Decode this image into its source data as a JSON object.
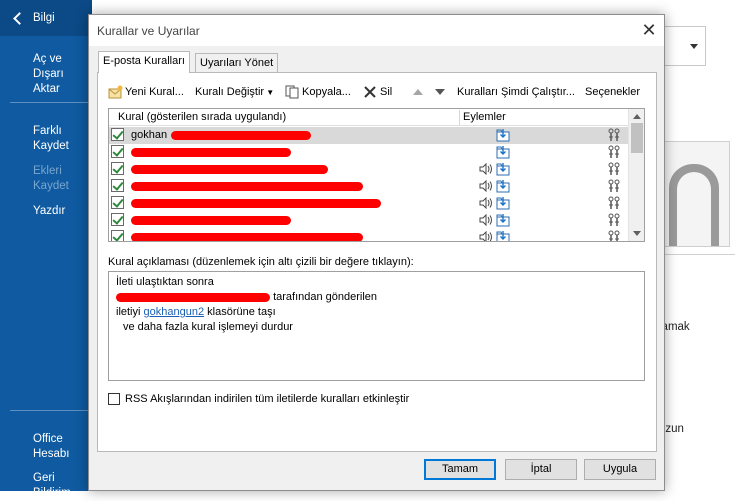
{
  "backstage": {
    "items": [
      {
        "label": "Bilgi"
      },
      {
        "label": "Aç ve Dışarı Aktar"
      },
      {
        "label": "Farklı Kaydet"
      },
      {
        "label": "Ekleri Kaydet"
      },
      {
        "label": "Yazdır"
      },
      {
        "label": "Office Hesabı"
      },
      {
        "label": "Geri Bildirim"
      }
    ]
  },
  "background": {
    "right_text_1": "lamak",
    "right_text_2": "uzun"
  },
  "dialog": {
    "title": "Kurallar ve Uyarılar",
    "close_symbol": "✕",
    "tabs": [
      {
        "label": "E-posta Kuralları",
        "selected": true
      },
      {
        "label": "Uyarıları Yönet",
        "selected": false
      }
    ],
    "toolbar": {
      "new_rule": "Yeni Kural...",
      "change_rule": "Kuralı Değiştir",
      "copy": "Kopyala...",
      "delete": "Sil",
      "run_now": "Kuralları Şimdi Çalıştır...",
      "options": "Seçenekler"
    },
    "rules_list": {
      "col_rule": "Kural (gösterilen sırada uygulandı)",
      "col_actions": "Eylemler",
      "rows": [
        {
          "name": "gokhan",
          "checked": true,
          "selected": true,
          "sound": false
        },
        {
          "name": "",
          "checked": true,
          "selected": false,
          "sound": false
        },
        {
          "name": "",
          "checked": true,
          "selected": false,
          "sound": true
        },
        {
          "name": "",
          "checked": true,
          "selected": false,
          "sound": true
        },
        {
          "name": "",
          "checked": true,
          "selected": false,
          "sound": true
        },
        {
          "name": "",
          "checked": true,
          "selected": false,
          "sound": true
        },
        {
          "name": "",
          "checked": true,
          "selected": false,
          "sound": true
        }
      ]
    },
    "description": {
      "label": "Kural açıklaması (düzenlemek için altı çizili bir değere tıklayın):",
      "line1": "İleti ulaştıktan sonra",
      "line2_suffix": "tarafından gönderilen",
      "line3_prefix": "iletiyi",
      "line3_link": "gokhangun2",
      "line3_suffix": "klasörüne taşı",
      "line4": "ve daha fazla kural işlemeyi durdur"
    },
    "rss_checkbox": {
      "label": "RSS Akışlarından indirilen tüm iletilerde kuralları etkinleştir",
      "checked": false
    },
    "buttons": {
      "ok": "Tamam",
      "cancel": "İptal",
      "apply": "Uygula"
    }
  }
}
